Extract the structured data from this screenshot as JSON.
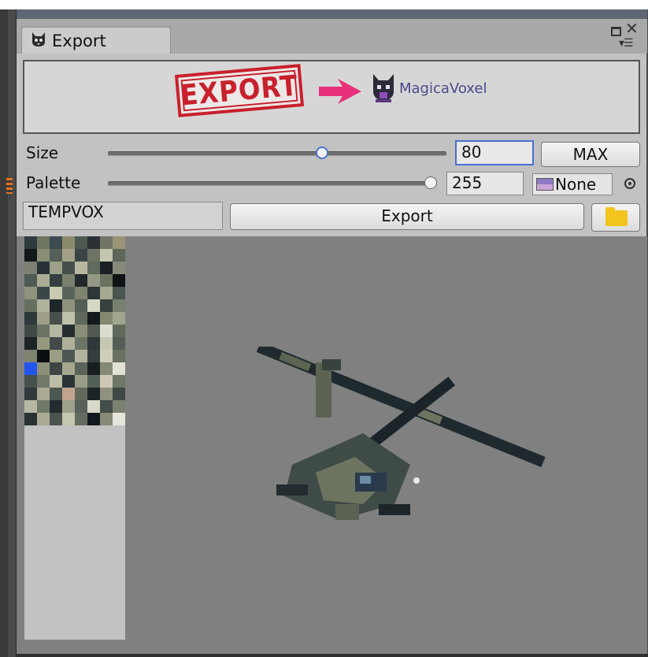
{
  "window": {
    "tab_label": "Export",
    "icon": "cat-icon",
    "controls": [
      "restore-icon",
      "close-icon",
      "menu-icon"
    ]
  },
  "banner": {
    "stamp_text": "EXPORT",
    "target_label": "MagicaVoxel",
    "colors": {
      "stamp": "#c8202c",
      "arrow": "#e8307a"
    }
  },
  "size": {
    "label": "Size",
    "value": "80",
    "slider_fraction": 0.62,
    "max_button": "MAX"
  },
  "palette": {
    "label": "Palette",
    "value": "255",
    "slider_fraction": 1.0,
    "object_field": "None"
  },
  "export": {
    "name_value": "TEMPVOX",
    "button_label": "Export",
    "folder_icon": "folder-icon"
  },
  "preview": {
    "palette_colors": [
      "#2f3a3e",
      "#6e7560",
      "#3d4a4f",
      "#8c8a6c",
      "#4d5a50",
      "#2a3034",
      "#707566",
      "#9a9478",
      "#11161a",
      "#8a8d74",
      "#545f58",
      "#a3a186",
      "#3a4447",
      "#6d7463",
      "#c4c6b0",
      "#5c6759",
      "#7b8072",
      "#283236",
      "#9da08a",
      "#444e4a",
      "#b8b8a0",
      "#606b5e",
      "#1a2024",
      "#868a78",
      "#4f5a54",
      "#abad96",
      "#33403f",
      "#7a806e",
      "#22292d",
      "#959884",
      "#6a725f",
      "#0e1215",
      "#90937e",
      "#3b4648",
      "#c9c9b4",
      "#58635a",
      "#7f846f",
      "#2c3538",
      "#a7a890",
      "#4a5551",
      "#66705f",
      "#b0b29c",
      "#1f272a",
      "#8f927c",
      "#525d55",
      "#d6d7c6",
      "#37423f",
      "#77806c",
      "#2d383a",
      "#9e9f88",
      "#474f4b",
      "#c0c1aa",
      "#5f6859",
      "#14191c",
      "#83886f",
      "#a1a58e",
      "#3f4a46",
      "#6b7363",
      "#b5b6a1",
      "#262e31",
      "#8b8e79",
      "#50594f",
      "#dcdcd0",
      "#606a5b",
      "#1c2326",
      "#96997f",
      "#414c49",
      "#aeb09a",
      "#6c7465",
      "#2e3739",
      "#c7c8b2",
      "#555e56",
      "#7e8370",
      "#0b0f12",
      "#9b9d86",
      "#4c5752",
      "#b3b49e",
      "#353e3c",
      "#cfcfbc",
      "#68705f",
      "#25ef",
      "#8d9078",
      "#3c4744",
      "#a5a78f",
      "#5a6358",
      "#181e21",
      "#848a74",
      "#e2e2d4",
      "#47524d",
      "#72796a",
      "#bcbda6",
      "#2a3336",
      "#999c86",
      "#536057",
      "#d0c8b6",
      "#6f7766",
      "#30393b",
      "#a9aa94",
      "#4e5852",
      "#c2a48e",
      "#62695b",
      "#1d2427",
      "#8f937d",
      "#3e4845",
      "#b7b8a4",
      "#707868",
      "#232b2e",
      "#9fa18b",
      "#58605a",
      "#d9d9ca",
      "#424c48",
      "#7c8270",
      "#283133",
      "#aaac96",
      "#4b544f",
      "#c5c6b0",
      "#636b5e",
      "#131a1d",
      "#868b76",
      "#e6e6dc"
    ],
    "colors": {
      "background": "#808080"
    }
  }
}
